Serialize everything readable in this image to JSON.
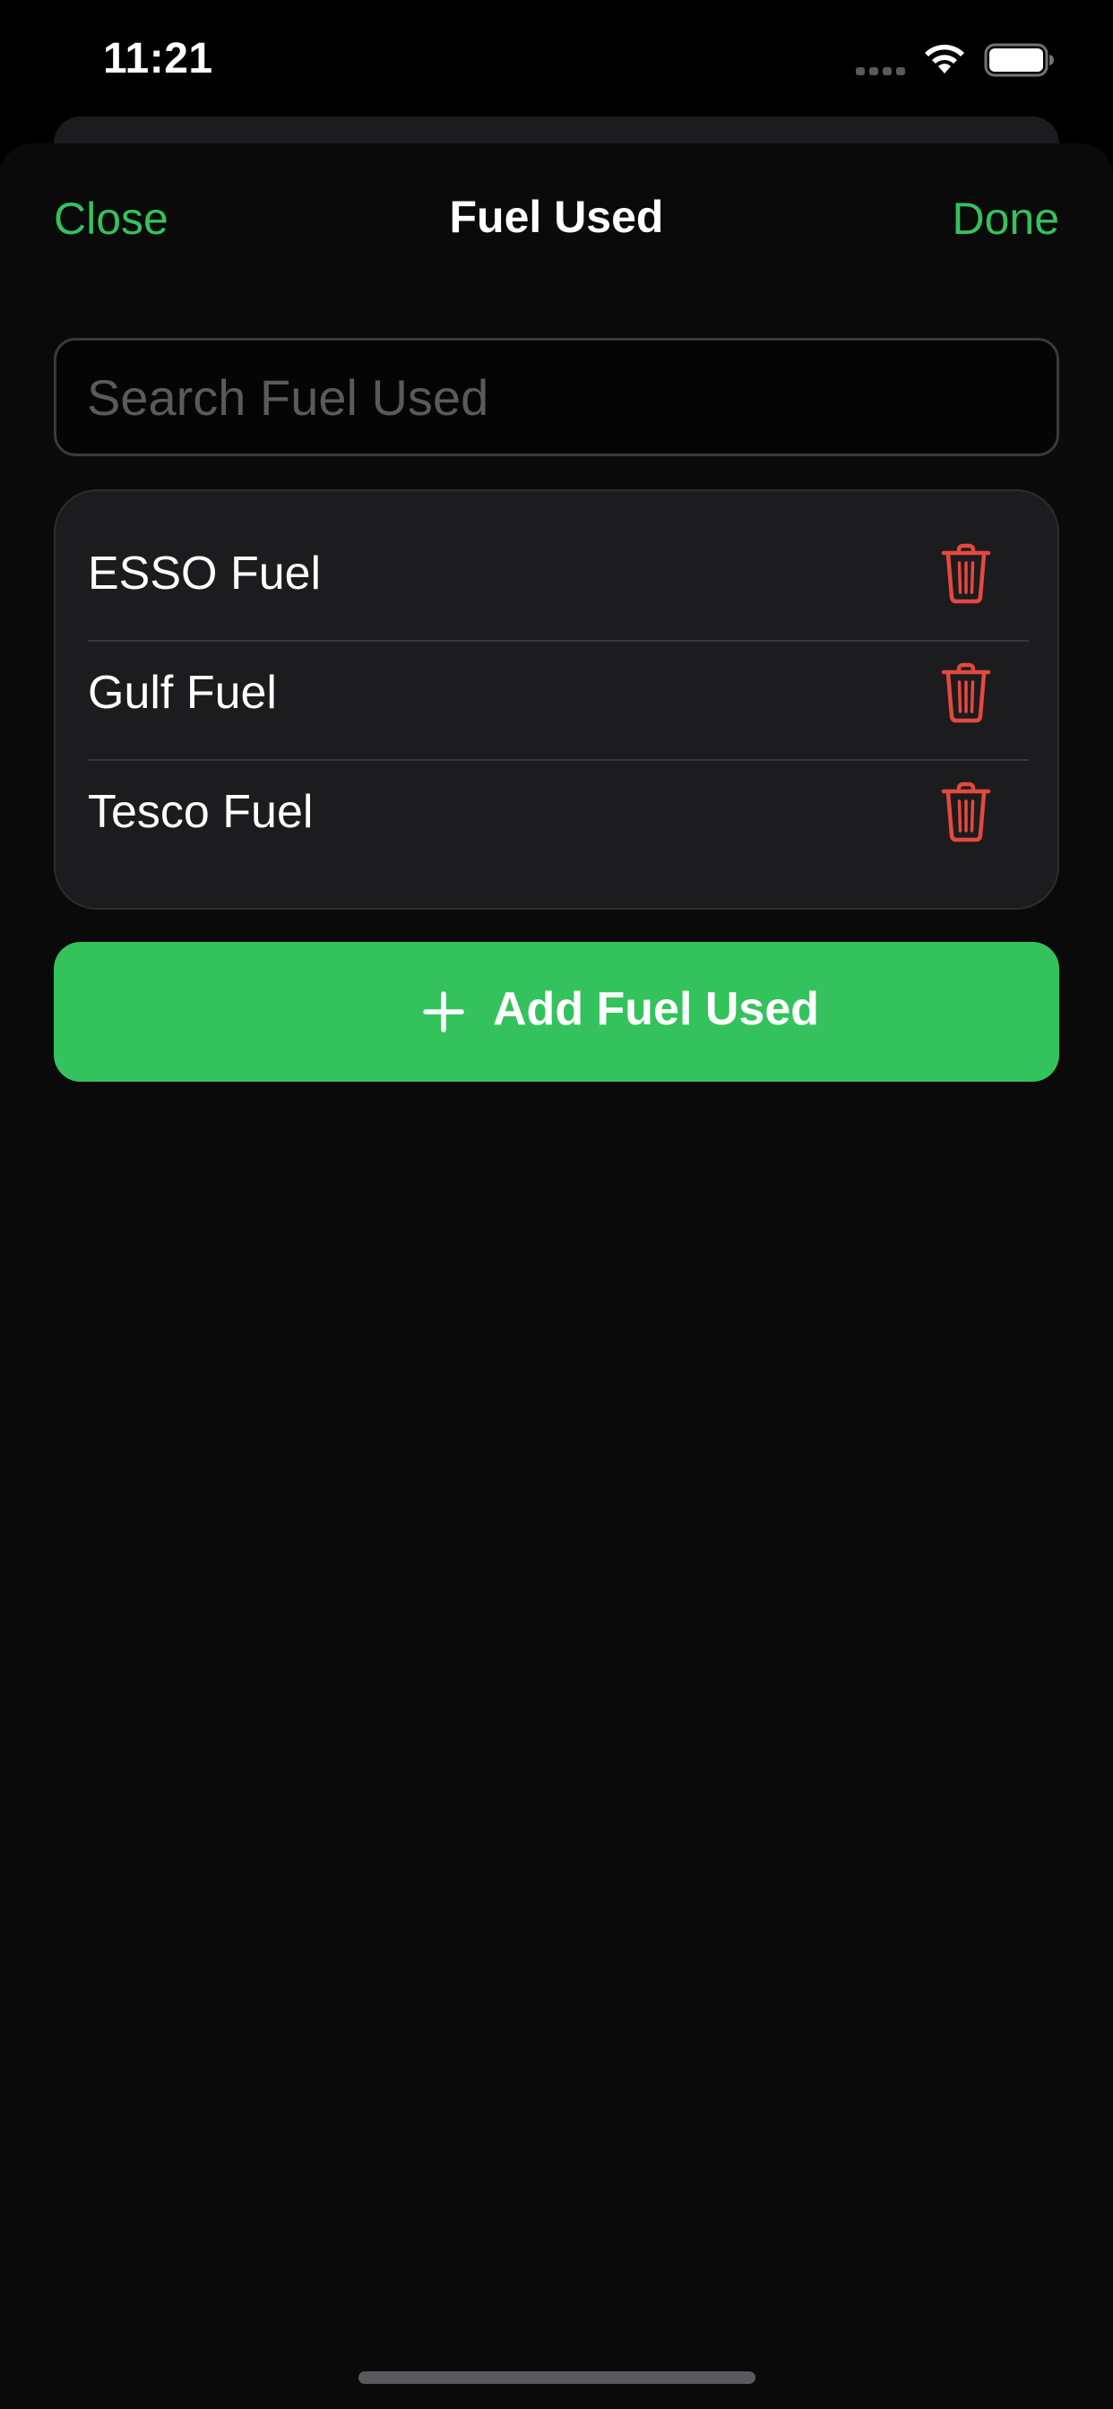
{
  "status_bar": {
    "time": "11:21"
  },
  "nav": {
    "close_label": "Close",
    "title": "Fuel Used",
    "done_label": "Done"
  },
  "search": {
    "placeholder": "Search Fuel Used",
    "value": ""
  },
  "list": {
    "items": [
      {
        "label": "ESSO Fuel",
        "action_icon": "trash-icon"
      },
      {
        "label": "Gulf Fuel",
        "action_icon": "trash-icon"
      },
      {
        "label": "Tesco Fuel",
        "action_icon": "trash-icon"
      }
    ]
  },
  "add_button": {
    "label": "Add Fuel Used",
    "icon": "plus-icon"
  },
  "colors": {
    "accent": "#34c25c",
    "destructive": "#e5483f",
    "background": "#0a0a0a",
    "card": "#1c1c1e"
  }
}
